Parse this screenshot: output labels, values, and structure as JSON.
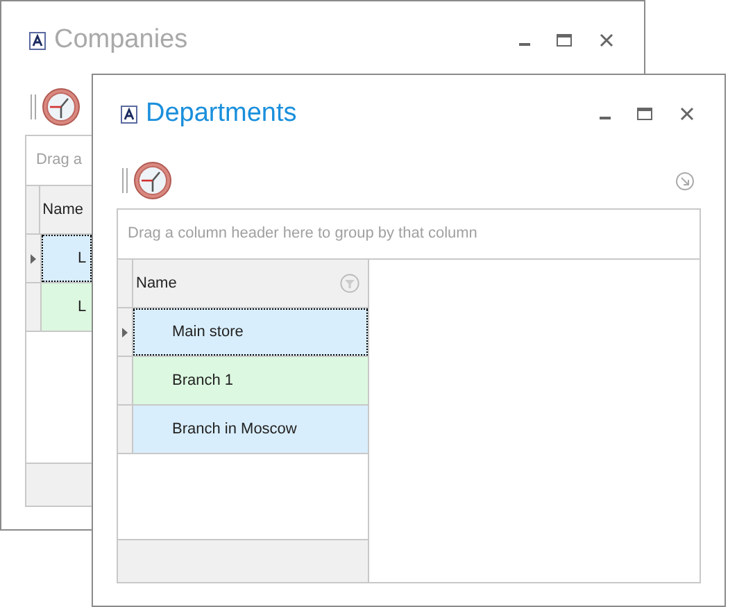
{
  "windows": [
    {
      "title": "Companies",
      "active": false,
      "group_panel": "Drag a",
      "column": "Name",
      "rows": [
        {
          "name": "L",
          "color": "#d9eefc",
          "selected": true
        },
        {
          "name": "L",
          "color": "#dcf8e0",
          "selected": false
        }
      ]
    },
    {
      "title": "Departments",
      "active": true,
      "group_panel": "Drag a column header here to group by that column",
      "column": "Name",
      "rows": [
        {
          "name": "Main store",
          "color": "#d9eefc",
          "selected": true
        },
        {
          "name": "Branch 1",
          "color": "#dcf8e0",
          "selected": false
        },
        {
          "name": "Branch in Moscow",
          "color": "#d9eefc",
          "selected": false
        }
      ]
    }
  ]
}
